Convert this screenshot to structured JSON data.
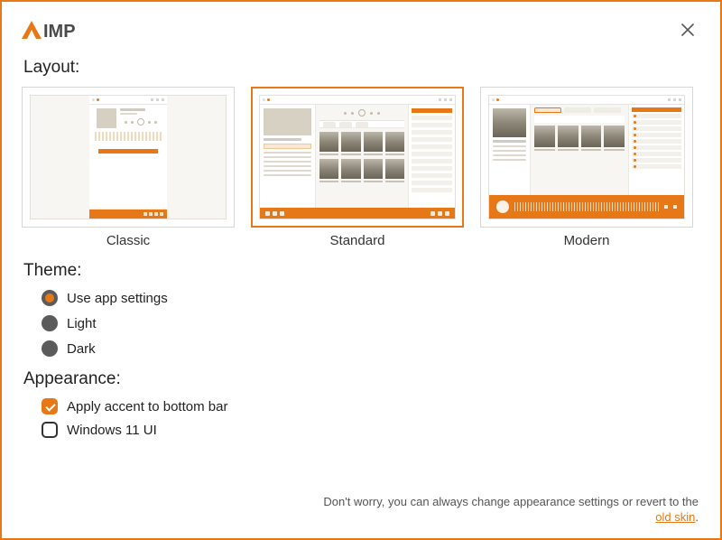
{
  "app": {
    "name": "AIMP"
  },
  "sections": {
    "layout_label": "Layout:",
    "theme_label": "Theme:",
    "appearance_label": "Appearance:"
  },
  "layout": {
    "selected": "standard",
    "options": {
      "classic": "Classic",
      "standard": "Standard",
      "modern": "Modern"
    }
  },
  "theme": {
    "selected": "app",
    "options": {
      "app": "Use app settings",
      "light": "Light",
      "dark": "Dark"
    }
  },
  "appearance": {
    "accent_bottom_bar": {
      "label": "Apply accent to bottom bar",
      "checked": true
    },
    "windows11_ui": {
      "label": "Windows 11 UI",
      "checked": false
    }
  },
  "footer": {
    "note_prefix": "Don't worry, you can always change appearance settings or revert to the ",
    "link_text": "old skin",
    "note_suffix": "."
  },
  "colors": {
    "accent": "#e67817"
  }
}
